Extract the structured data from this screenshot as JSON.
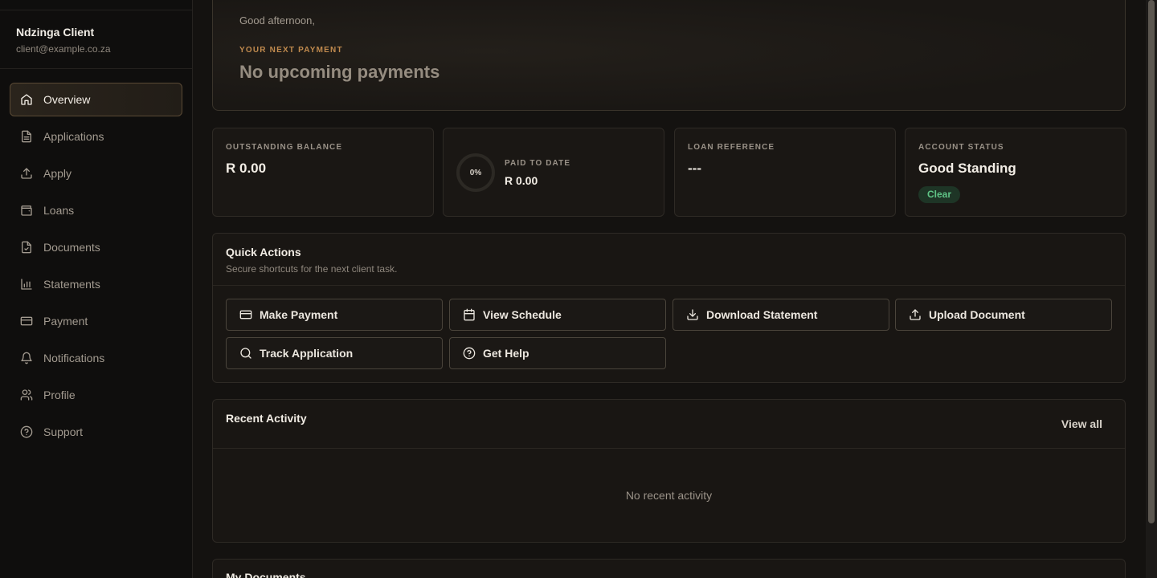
{
  "user": {
    "name": "Ndzinga Client",
    "email": "client@example.co.za"
  },
  "nav": [
    {
      "label": "Overview",
      "icon": "home-icon",
      "active": true
    },
    {
      "label": "Applications",
      "icon": "file-text-icon"
    },
    {
      "label": "Apply",
      "icon": "upload-icon"
    },
    {
      "label": "Loans",
      "icon": "wallet-icon"
    },
    {
      "label": "Documents",
      "icon": "file-check-icon"
    },
    {
      "label": "Statements",
      "icon": "bar-chart-icon"
    },
    {
      "label": "Payment",
      "icon": "credit-card-icon"
    },
    {
      "label": "Notifications",
      "icon": "bell-icon"
    },
    {
      "label": "Profile",
      "icon": "users-icon"
    },
    {
      "label": "Support",
      "icon": "help-circle-icon"
    }
  ],
  "hero": {
    "greeting": "Good afternoon,",
    "next_label": "YOUR NEXT PAYMENT",
    "next_value": "No upcoming payments"
  },
  "cards": {
    "balance": {
      "label": "OUTSTANDING BALANCE",
      "value": "R 0.00"
    },
    "paid": {
      "label": "PAID TO DATE",
      "value": "R 0.00",
      "percent_text": "0%",
      "progress": 0
    },
    "loan_ref": {
      "label": "LOAN REFERENCE",
      "value": "---"
    },
    "status": {
      "label": "ACCOUNT STATUS",
      "value": "Good Standing",
      "badge": "Clear"
    }
  },
  "quick_actions": {
    "title": "Quick Actions",
    "subtitle": "Secure shortcuts for the next client task.",
    "buttons": [
      {
        "label": "Make Payment",
        "icon": "credit-card-icon"
      },
      {
        "label": "View Schedule",
        "icon": "calendar-icon"
      },
      {
        "label": "Download Statement",
        "icon": "download-icon"
      },
      {
        "label": "Upload Document",
        "icon": "upload-icon"
      },
      {
        "label": "Track Application",
        "icon": "search-icon"
      },
      {
        "label": "Get Help",
        "icon": "help-circle-icon"
      }
    ]
  },
  "recent_activity": {
    "title": "Recent Activity",
    "view_all": "View all",
    "empty": "No recent activity"
  },
  "my_documents": {
    "title": "My Documents"
  },
  "colors": {
    "accent": "#c08a4e",
    "success": "#5fc486",
    "background": "#141210"
  }
}
